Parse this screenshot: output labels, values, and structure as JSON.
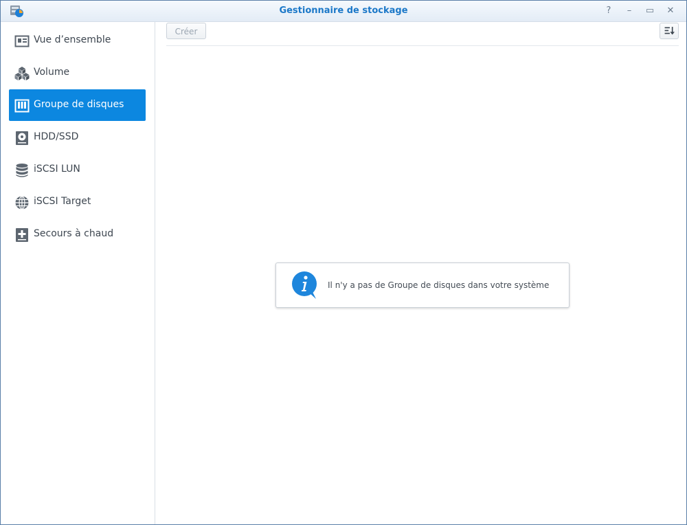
{
  "window": {
    "title": "Gestionnaire de stockage",
    "controls": {
      "help_glyph": "?",
      "minimize_glyph": "–",
      "maximize_glyph": "▭",
      "close_glyph": "✕"
    }
  },
  "sidebar": {
    "items": [
      {
        "label": "Vue d’ensemble",
        "icon": "overview-icon",
        "active": false
      },
      {
        "label": "Volume",
        "icon": "volume-icon",
        "active": false
      },
      {
        "label": "Groupe de disques",
        "icon": "disk-group-icon",
        "active": true
      },
      {
        "label": "HDD/SSD",
        "icon": "hdd-icon",
        "active": false
      },
      {
        "label": "iSCSI LUN",
        "icon": "database-icon",
        "active": false
      },
      {
        "label": "iSCSI Target",
        "icon": "globe-icon",
        "active": false
      },
      {
        "label": "Secours à chaud",
        "icon": "hot-spare-icon",
        "active": false
      }
    ]
  },
  "toolbar": {
    "create_label": "Créer",
    "sort_icon": "sort-icon"
  },
  "empty_state": {
    "message": "Il n'y a pas de Groupe de disques dans votre système",
    "icon": "info-icon"
  },
  "colors": {
    "accent": "#0c87e0",
    "title": "#1b78c8",
    "icon_gray": "#5d6670"
  }
}
